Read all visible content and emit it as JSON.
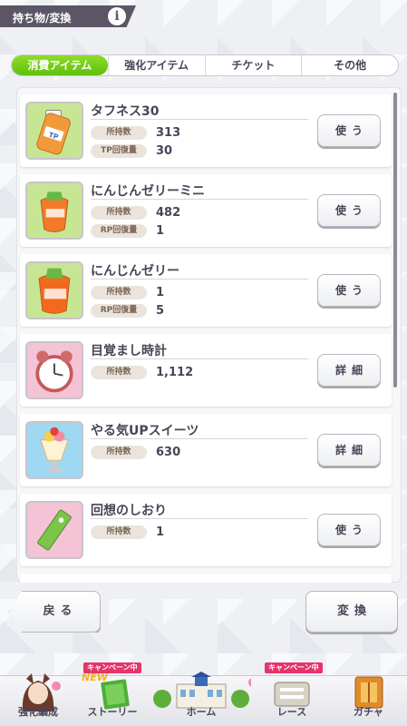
{
  "header": {
    "title": "持ち物/変換",
    "info_icon": "i"
  },
  "tabs": [
    {
      "label": "消費アイテム",
      "active": true
    },
    {
      "label": "強化アイテム",
      "active": false
    },
    {
      "label": "チケット",
      "active": false
    },
    {
      "label": "その他",
      "active": false
    }
  ],
  "items": [
    {
      "name": "タフネス30",
      "stats": [
        {
          "label": "所持数",
          "value": "313"
        },
        {
          "label": "TP回復量",
          "value": "30"
        }
      ],
      "action": "使う",
      "icon": "tp-bottle-icon",
      "thumb_color": "#b9e07a"
    },
    {
      "name": "にんじんゼリーミニ",
      "stats": [
        {
          "label": "所持数",
          "value": "482"
        },
        {
          "label": "RP回復量",
          "value": "1"
        }
      ],
      "action": "使う",
      "icon": "carrot-jelly-mini-icon",
      "thumb_color": "#b9e07a"
    },
    {
      "name": "にんじんゼリー",
      "stats": [
        {
          "label": "所持数",
          "value": "1"
        },
        {
          "label": "RP回復量",
          "value": "5"
        }
      ],
      "action": "使う",
      "icon": "carrot-jelly-icon",
      "thumb_color": "#b9e07a"
    },
    {
      "name": "目覚まし時計",
      "stats": [
        {
          "label": "所持数",
          "value": "1,112"
        }
      ],
      "action": "詳細",
      "icon": "alarm-clock-icon",
      "thumb_color": "#f6b9cf"
    },
    {
      "name": "やる気UPスイーツ",
      "stats": [
        {
          "label": "所持数",
          "value": "630"
        }
      ],
      "action": "詳細",
      "icon": "parfait-icon",
      "thumb_color": "#8fd3f0"
    },
    {
      "name": "回想のしおり",
      "stats": [
        {
          "label": "所持数",
          "value": "1"
        }
      ],
      "action": "使う",
      "icon": "bookmark-icon",
      "thumb_color": "#f6b9cf"
    }
  ],
  "buttons": {
    "back": "戻る",
    "convert": "変換"
  },
  "nav": [
    {
      "label": "強化編成",
      "badge": ""
    },
    {
      "label": "ストーリー",
      "badge": "キャンペーン中"
    },
    {
      "label": "ホーム",
      "badge": ""
    },
    {
      "label": "レース",
      "badge": "キャンペーン中"
    },
    {
      "label": "ガチャ",
      "badge": ""
    }
  ],
  "new_badge": "NEW",
  "colors": {
    "accent_green": "#6cc61a",
    "text_dark": "#4a4458",
    "badge_pink": "#e5336b"
  }
}
